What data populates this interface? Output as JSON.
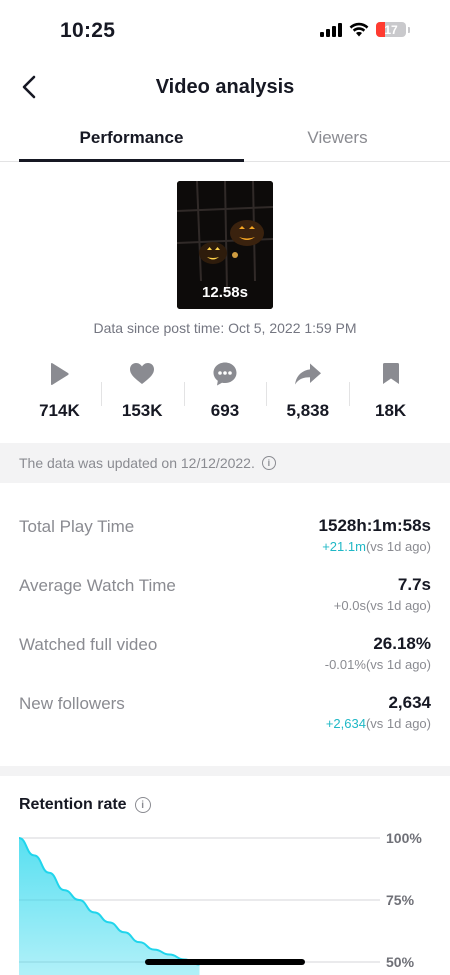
{
  "status_bar": {
    "time": "10:25",
    "battery": "17"
  },
  "nav": {
    "title": "Video analysis"
  },
  "tabs": [
    {
      "label": "Performance",
      "active": true
    },
    {
      "label": "Viewers",
      "active": false
    }
  ],
  "video": {
    "duration": "12.58s",
    "data_since": "Data since post time: Oct 5, 2022 1:59 PM"
  },
  "stats": [
    {
      "icon": "play-icon",
      "value": "714K"
    },
    {
      "icon": "heart-icon",
      "value": "153K"
    },
    {
      "icon": "comment-icon",
      "value": "693"
    },
    {
      "icon": "share-icon",
      "value": "5,838"
    },
    {
      "icon": "bookmark-icon",
      "value": "18K"
    }
  ],
  "update_banner": "The data was updated on 12/12/2022.",
  "metrics": [
    {
      "label": "Total Play Time",
      "value": "1528h:1m:58s",
      "delta": "+21.1m",
      "delta_color": "#20b8c6",
      "compare": "(vs 1d ago)"
    },
    {
      "label": "Average Watch Time",
      "value": "7.7s",
      "delta": "+0.0s",
      "delta_color": "#8a8b91",
      "compare": "(vs 1d ago)"
    },
    {
      "label": "Watched full video",
      "value": "26.18%",
      "delta": "-0.01%",
      "delta_color": "#8a8b91",
      "compare": "(vs 1d ago)"
    },
    {
      "label": "New followers",
      "value": "2,634",
      "delta": "+2,634",
      "delta_color": "#20b8c6",
      "compare": "(vs 1d ago)"
    }
  ],
  "retention": {
    "title": "Retention rate",
    "y_ticks": [
      "100%",
      "75%",
      "50%"
    ],
    "accent_color": "#20d5ec"
  },
  "chart_data": {
    "type": "area",
    "title": "Retention rate",
    "xlabel": "",
    "ylabel": "",
    "ylim": [
      50,
      100
    ],
    "y_ticks": [
      100,
      75,
      50
    ],
    "series": [
      {
        "values": [
          100,
          93,
          86,
          79,
          75,
          70,
          66,
          62,
          58,
          55,
          53,
          51,
          49
        ]
      }
    ],
    "grid": true
  }
}
